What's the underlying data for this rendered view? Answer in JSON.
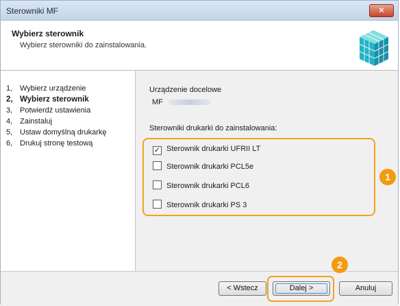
{
  "window": {
    "title": "Sterowniki MF",
    "close_label": "✕"
  },
  "header": {
    "title": "Wybierz sterownik",
    "subtitle": "Wybierz sterowniki do zainstalowania.",
    "logo_icon": "cube-stack-icon"
  },
  "steps": [
    {
      "num": "1,",
      "label": "Wybierz urządzenie",
      "active": false
    },
    {
      "num": "2,",
      "label": "Wybierz sterownik",
      "active": true
    },
    {
      "num": "3,",
      "label": "Potwierdź ustawienia",
      "active": false
    },
    {
      "num": "4,",
      "label": "Zainstaluj",
      "active": false
    },
    {
      "num": "5,",
      "label": "Ustaw domyślną drukarkę",
      "active": false
    },
    {
      "num": "6,",
      "label": "Drukuj stronę testową",
      "active": false
    }
  ],
  "content": {
    "target_label": "Urządzenie docelowe",
    "target_value": "MF",
    "drivers_label": "Sterowniki drukarki do zainstalowania:",
    "drivers": [
      {
        "label": "Sterownik drukarki UFRII LT",
        "checked": true
      },
      {
        "label": "Sterownik drukarki PCL5e",
        "checked": false
      },
      {
        "label": "Sterownik drukarki PCL6",
        "checked": false
      },
      {
        "label": "Sterownik drukarki PS 3",
        "checked": false
      }
    ]
  },
  "callouts": {
    "one": "1",
    "two": "2",
    "color": "#f29b0d"
  },
  "footer": {
    "back_label": "< Wstecz",
    "next_label": "Dalej >",
    "cancel_label": "Anuluj"
  }
}
